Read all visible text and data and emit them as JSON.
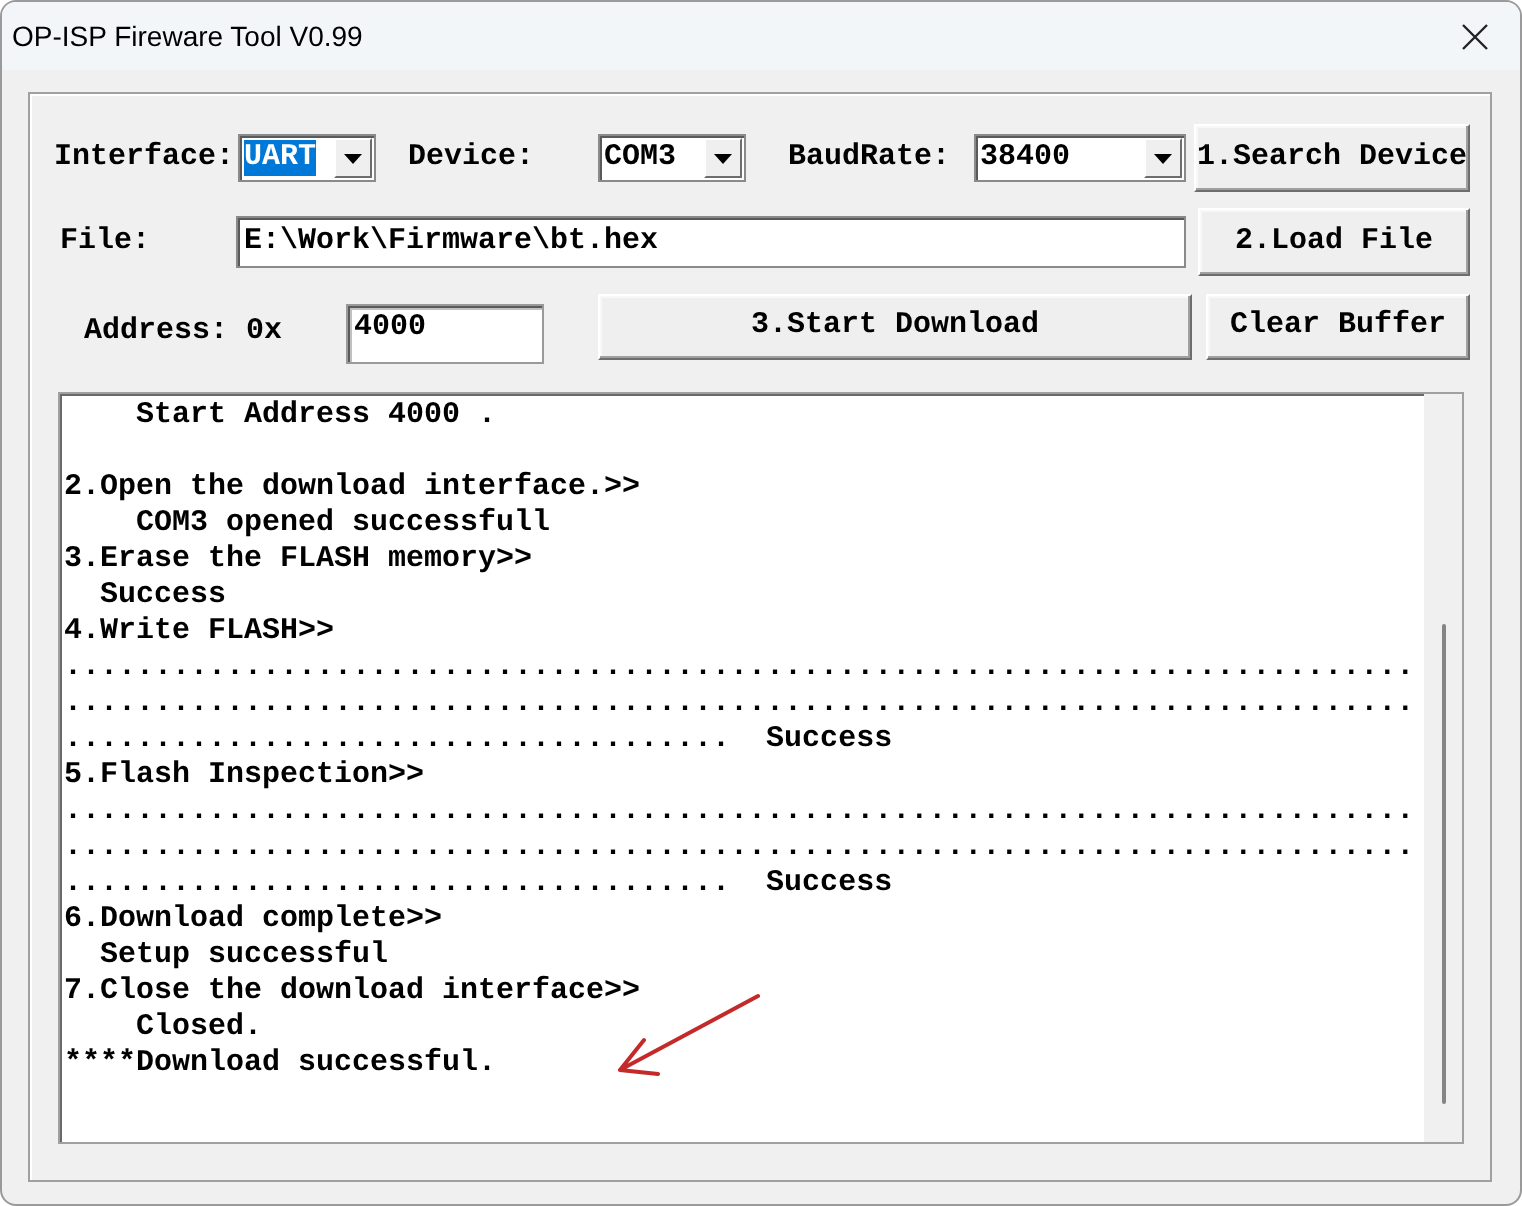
{
  "window": {
    "title": "OP-ISP Fireware Tool V0.99"
  },
  "selectors": [
    {
      "label": "Interface:",
      "value": "UART",
      "focused": true
    },
    {
      "label": "Device:",
      "value": "COM3",
      "focused": false
    },
    {
      "label": "BaudRate:",
      "value": "38400",
      "focused": false
    }
  ],
  "search_button": "1.Search Device",
  "file": {
    "label": "File:",
    "value": "E:\\Work\\Firmware\\bt.hex"
  },
  "load_button": "2.Load File",
  "address": {
    "label": "Address: 0x",
    "value": "4000"
  },
  "start_button": "3.Start Download",
  "clear_button": "Clear Buffer",
  "log": {
    "paragraphs": [
      [
        "    Start Address 4000 ."
      ],
      [
        "2.Open the download interface.>>",
        "    COM3 opened successfull",
        "3.Erase the FLASH memory>>",
        "  Success",
        "4.Write FLASH>>",
        "...........................................................................",
        "...........................................................................",
        ".....................................  Success",
        "5.Flash Inspection>>",
        "...........................................................................",
        "...........................................................................",
        ".....................................  Success",
        "6.Download complete>>",
        "  Setup successful",
        "7.Close the download interface>>",
        "    Closed.",
        "****Download successful."
      ]
    ]
  }
}
